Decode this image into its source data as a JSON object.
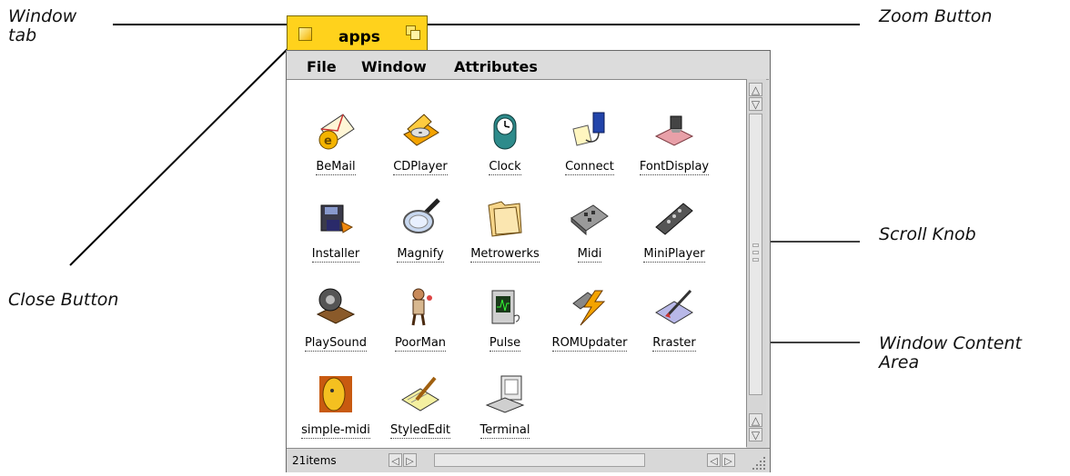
{
  "callouts": {
    "window_tab": [
      "Window",
      "tab"
    ],
    "zoom_button": "Zoom Button",
    "scroll_knob": "Scroll Knob",
    "close_button": "Close Button",
    "window_content_area": [
      "Window Content",
      "Area"
    ]
  },
  "window": {
    "title": "apps",
    "menu": [
      "File",
      "Window",
      "Attributes"
    ],
    "item_count": "21items",
    "tab_color": "#ffd21c"
  },
  "items": [
    {
      "label": "BeMail",
      "icon": "bemail-icon"
    },
    {
      "label": "CDPlayer",
      "icon": "cdplayer-icon"
    },
    {
      "label": "Clock",
      "icon": "clock-icon"
    },
    {
      "label": "Connect",
      "icon": "connect-icon"
    },
    {
      "label": "FontDisplay",
      "icon": "fontdisplay-icon"
    },
    {
      "label": "Installer",
      "icon": "installer-icon"
    },
    {
      "label": "Magnify",
      "icon": "magnify-icon"
    },
    {
      "label": "Metrowerks",
      "icon": "metrowerks-icon"
    },
    {
      "label": "Midi",
      "icon": "midi-icon"
    },
    {
      "label": "MiniPlayer",
      "icon": "miniplayer-icon"
    },
    {
      "label": "PlaySound",
      "icon": "playsound-icon"
    },
    {
      "label": "PoorMan",
      "icon": "poorman-icon"
    },
    {
      "label": "Pulse",
      "icon": "pulse-icon"
    },
    {
      "label": "ROMUpdater",
      "icon": "romupdater-icon"
    },
    {
      "label": "Rraster",
      "icon": "rraster-icon"
    },
    {
      "label": "simple-midi",
      "icon": "simple-midi-icon"
    },
    {
      "label": "StyledEdit",
      "icon": "stylededit-icon"
    },
    {
      "label": "Terminal",
      "icon": "terminal-icon"
    }
  ]
}
